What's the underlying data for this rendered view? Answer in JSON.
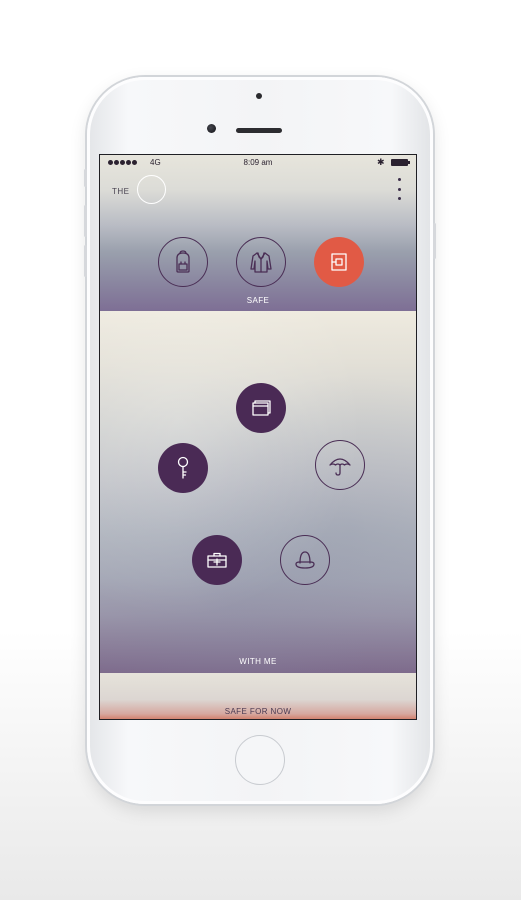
{
  "status_bar": {
    "carrier": "4G",
    "time": "8:09 am",
    "bluetooth_symbol": "✱"
  },
  "header": {
    "title": "THE",
    "menu_icon": "vertical-dots-icon"
  },
  "safe_section": {
    "label": "SAFE",
    "items": [
      {
        "name": "backpack",
        "icon": "backpack-icon",
        "style": "outline"
      },
      {
        "name": "jacket",
        "icon": "jacket-icon",
        "style": "outline"
      },
      {
        "name": "document",
        "icon": "document-icon",
        "style": "accent"
      }
    ]
  },
  "with_me_section": {
    "label": "WITH ME",
    "items": [
      {
        "name": "wallet",
        "icon": "wallet-icon",
        "style": "filled"
      },
      {
        "name": "key",
        "icon": "key-icon",
        "style": "filled"
      },
      {
        "name": "umbrella",
        "icon": "umbrella-icon",
        "style": "outline"
      },
      {
        "name": "first-aid-kit",
        "icon": "first-aid-kit-icon",
        "style": "filled"
      },
      {
        "name": "hat",
        "icon": "hat-icon",
        "style": "outline"
      }
    ]
  },
  "safe_for_now_section": {
    "label": "SAFE FOR NOW"
  },
  "colors": {
    "accent": "#e15a45",
    "primary": "#4a2a55"
  }
}
